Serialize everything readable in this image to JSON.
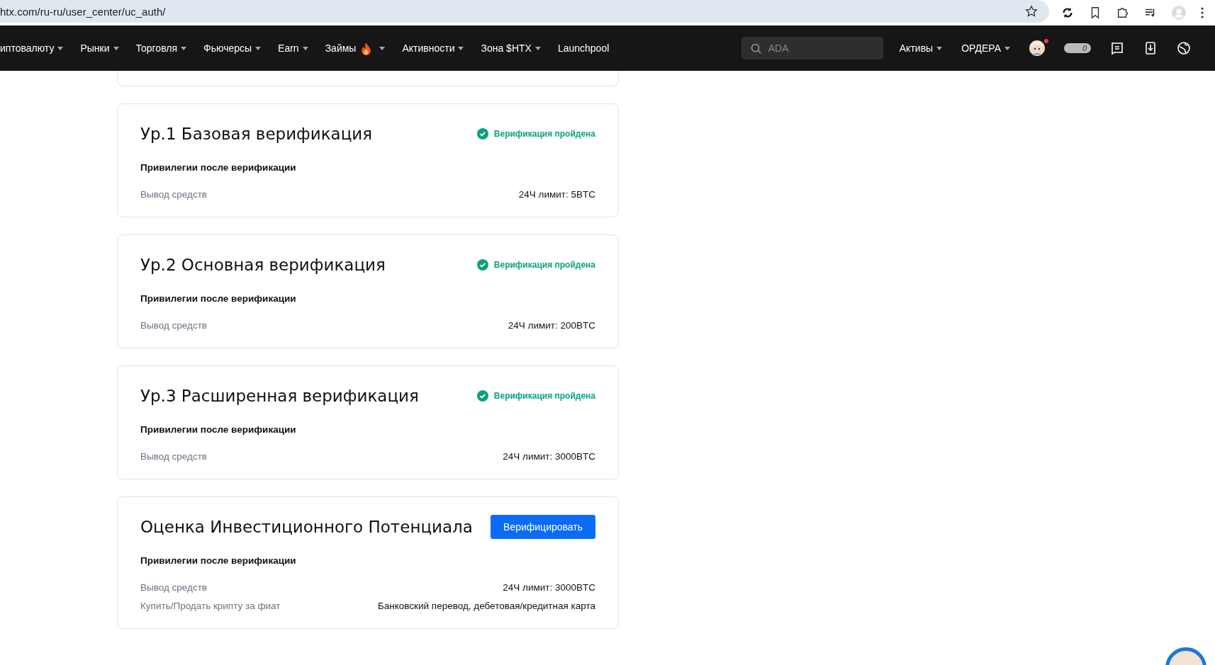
{
  "browser": {
    "url": "htx.com/ru-ru/user_center/uc_auth/"
  },
  "nav": {
    "items": [
      {
        "label": "иптовалюту",
        "dropdown": true,
        "hot": false
      },
      {
        "label": "Рынки",
        "dropdown": true,
        "hot": false
      },
      {
        "label": "Торговля",
        "dropdown": true,
        "hot": false
      },
      {
        "label": "Фьючерсы",
        "dropdown": true,
        "hot": false
      },
      {
        "label": "Earn",
        "dropdown": true,
        "hot": false
      },
      {
        "label": "Займы",
        "dropdown": true,
        "hot": true
      },
      {
        "label": "Активности",
        "dropdown": true,
        "hot": false
      },
      {
        "label": "Зона $HTX",
        "dropdown": true,
        "hot": false
      },
      {
        "label": "Launchpool",
        "dropdown": false,
        "hot": false
      }
    ],
    "search": {
      "placeholder": "ADA"
    },
    "right_items": [
      {
        "label": "Активы",
        "dropdown": true
      },
      {
        "label": "ОРДЕРА",
        "dropdown": true
      }
    ],
    "avatar": {
      "notification": true
    },
    "toggle": {
      "text": "0",
      "on": false
    }
  },
  "cards": [
    {
      "title": "Ур.1 Базовая верификация",
      "status": {
        "kind": "verified",
        "text": "Верификация пройдена"
      },
      "subtitle": "Привилегии после верификации",
      "rows": [
        {
          "label": "Вывод средств",
          "value": "24Ч лимит: 5BTC"
        }
      ]
    },
    {
      "title": "Ур.2 Основная верификация",
      "status": {
        "kind": "verified",
        "text": "Верификация пройдена"
      },
      "subtitle": "Привилегии после верификации",
      "rows": [
        {
          "label": "Вывод средств",
          "value": "24Ч лимит: 200BTC"
        }
      ]
    },
    {
      "title": "Ур.3 Расширенная верификация",
      "status": {
        "kind": "verified",
        "text": "Верификация пройдена"
      },
      "subtitle": "Привилегии после верификации",
      "rows": [
        {
          "label": "Вывод средств",
          "value": "24Ч лимит: 3000BTC"
        }
      ]
    },
    {
      "title": "Оценка Инвестиционного Потенциала",
      "status": {
        "kind": "button",
        "text": "Верифицировать"
      },
      "subtitle": "Привилегии после верификации",
      "rows": [
        {
          "label": "Вывод средств",
          "value": "24Ч лимит: 3000BTC"
        },
        {
          "label": "Купить/Продать крипту за фиат",
          "value": "Банковский перевод, дебетовая/кредитная карта"
        }
      ]
    }
  ]
}
